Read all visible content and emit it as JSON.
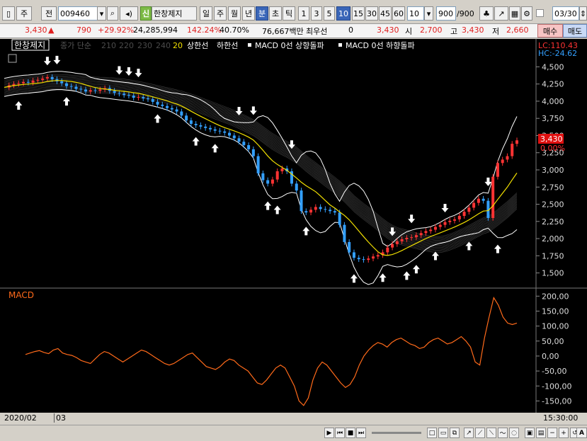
{
  "toolbar": {
    "chart_type_label": "주",
    "chart_option_label": "전",
    "code": "009460",
    "name_badge": "신",
    "stock_name": "한창제지",
    "periods": [
      "일",
      "주",
      "월",
      "년",
      "분",
      "초",
      "틱"
    ],
    "active_period": "분",
    "intervals": [
      "1",
      "3",
      "5",
      "10",
      "15",
      "30",
      "45",
      "60"
    ],
    "active_interval": "10",
    "interval_select": "10",
    "count": "900",
    "count_total": "900",
    "date": "03/30"
  },
  "quote": {
    "price": "3,430",
    "change": "790",
    "change_pct": "+29.92%",
    "volume": "24,285,994",
    "vol_ratio": "142.24%",
    "turnover": "40.70%",
    "amount": "76,667백만",
    "best_bid_label": "최우선",
    "best_bid_qty": "0",
    "best_bid": "3,430",
    "open_label": "시",
    "open": "2,700",
    "high": "3,430",
    "low_label": "저",
    "low": "2,660",
    "buy_label": "매수",
    "sell_label": "매도"
  },
  "legend": {
    "name": "한창제지",
    "ma_label": "종가 단순",
    "ma_periods": [
      "210",
      "220",
      "230",
      "240"
    ],
    "ma20": "20",
    "upper": "상한선",
    "lower": "하한선",
    "macd_up": "MACD 0선 상향돌파",
    "macd_down": "MACD 0선 하향돌파",
    "lc": "LC:110.43",
    "hc": "HC:-24.62",
    "price_tag": "3,430",
    "pct_tag": "0.00%"
  },
  "macd_label": "MACD",
  "x_labels": [
    "2020/02",
    "03"
  ],
  "time": "15:30:00",
  "colors": {
    "up": "#ff3333",
    "down": "#33a0ff",
    "ma20": "#f2e000",
    "band": "#ffffff",
    "macd": "#ff6a1a",
    "grid": "#3a3a3a"
  },
  "chart_data": [
    {
      "type": "line",
      "title": "한창제지",
      "ylim": [
        1300,
        4700
      ],
      "y_ticks": [
        4500,
        4250,
        4000,
        3750,
        3500,
        3250,
        3000,
        2750,
        2500,
        2250,
        2000,
        1750,
        1500
      ],
      "y_tick_labels": [
        "4,500",
        "4,250",
        "4,000",
        "3,750",
        "3,500",
        "3,250",
        "3,000",
        "2,750",
        "2,500",
        "2,250",
        "2,000",
        "1,750",
        "1,500"
      ],
      "series": [
        {
          "name": "종가",
          "values": [
            4200,
            4230,
            4250,
            4260,
            4280,
            4270,
            4300,
            4310,
            4330,
            4350,
            4320,
            4290,
            4260,
            4220,
            4210,
            4180,
            4170,
            4140,
            4160,
            4150,
            4170,
            4190,
            4150,
            4120,
            4110,
            4090,
            4080,
            4050,
            4060,
            4040,
            4030,
            3990,
            3950,
            3930,
            3900,
            3880,
            3850,
            3790,
            3720,
            3670,
            3650,
            3630,
            3610,
            3590,
            3570,
            3560,
            3540,
            3500,
            3460,
            3410,
            3360,
            3300,
            3200,
            2950,
            2850,
            2800,
            2860,
            2980,
            3020,
            2980,
            2800,
            2700,
            2400,
            2380,
            2420,
            2460,
            2430,
            2420,
            2400,
            2380,
            2200,
            1950,
            1800,
            1720,
            1700,
            1690,
            1710,
            1740,
            1760,
            1800,
            1870,
            1920,
            1960,
            1990,
            2010,
            2020,
            2050,
            2080,
            2110,
            2130,
            2170,
            2200,
            2240,
            2260,
            2280,
            2330,
            2390,
            2450,
            2520,
            2580,
            2550,
            2300,
            2900,
            3100,
            3150,
            3200,
            3380,
            3430
          ]
        }
      ],
      "markers_up": [
        "3",
        "13",
        "32",
        "40",
        "44",
        "55",
        "57",
        "63",
        "73",
        "79",
        "84",
        "86",
        "90",
        "97",
        "103"
      ],
      "markers_down": [
        "9",
        "11",
        "24",
        "26",
        "28",
        "49",
        "52",
        "60",
        "81",
        "85",
        "92",
        "101"
      ]
    },
    {
      "type": "line",
      "title": "MACD",
      "ylim": [
        -175,
        215
      ],
      "y_ticks": [
        200,
        150,
        100,
        50,
        0,
        -50,
        -100,
        -150
      ],
      "y_tick_labels": [
        "200,00",
        "150,00",
        "100,00",
        "50,00",
        "0,00",
        "-50,00",
        "-100,00",
        "-150,00"
      ],
      "series": [
        {
          "name": "MACD",
          "values": [
            5,
            10,
            15,
            18,
            12,
            8,
            20,
            25,
            10,
            5,
            2,
            -5,
            -15,
            -20,
            -25,
            -10,
            5,
            15,
            10,
            0,
            -10,
            -20,
            -10,
            0,
            10,
            20,
            15,
            5,
            -5,
            -15,
            -25,
            -30,
            -25,
            -15,
            -5,
            5,
            10,
            -5,
            -20,
            -35,
            -40,
            -45,
            -35,
            -20,
            -10,
            -15,
            -30,
            -40,
            -50,
            -70,
            -90,
            -95,
            -80,
            -60,
            -40,
            -30,
            -40,
            -70,
            -100,
            -150,
            -165,
            -140,
            -80,
            -40,
            -20,
            -30,
            -50,
            -70,
            -90,
            -105,
            -95,
            -70,
            -30,
            0,
            20,
            35,
            45,
            40,
            30,
            45,
            55,
            60,
            50,
            40,
            35,
            25,
            30,
            45,
            55,
            60,
            50,
            40,
            45,
            55,
            65,
            50,
            30,
            -20,
            -30,
            60,
            130,
            195,
            170,
            130,
            110,
            105,
            110
          ]
        }
      ]
    }
  ]
}
